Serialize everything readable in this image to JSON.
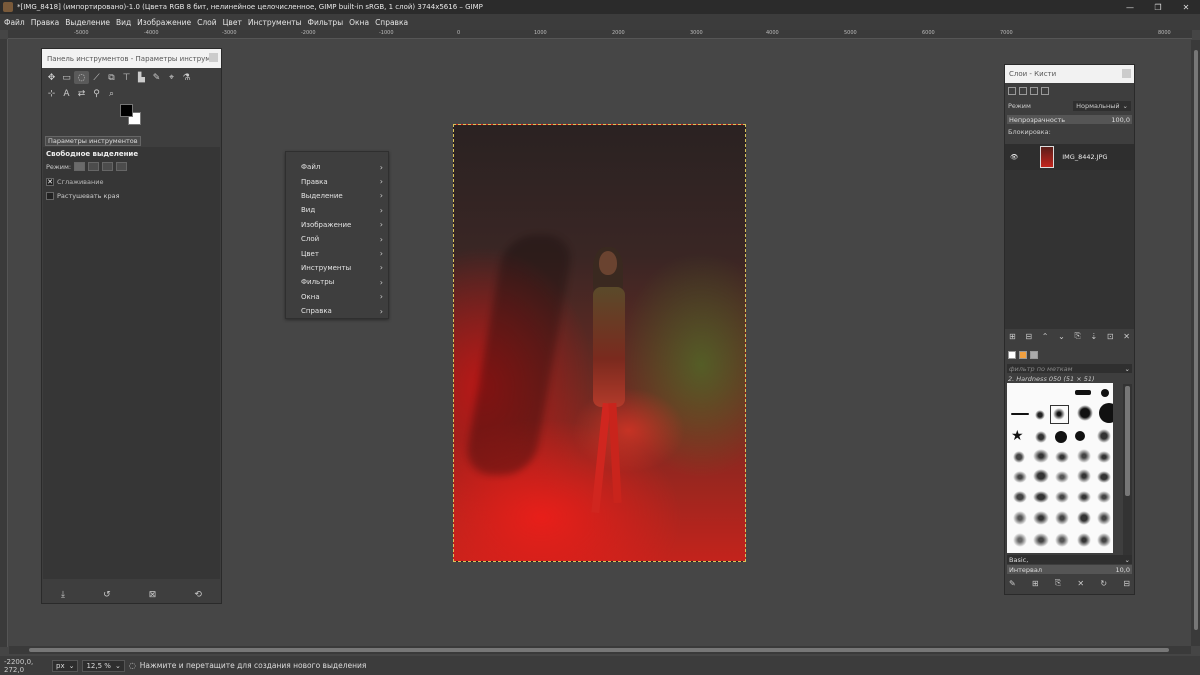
{
  "window": {
    "title": "*[IMG_8418] (импортировано)-1.0 (Цвета RGB 8 бит, нелинейное целочисленное, GIMP built-in sRGB, 1 слой) 3744x5616 – GIMP",
    "controls": [
      "—",
      "❐",
      "✕"
    ]
  },
  "menubar": [
    "Файл",
    "Правка",
    "Выделение",
    "Вид",
    "Изображение",
    "Слой",
    "Цвет",
    "Инструменты",
    "Фильтры",
    "Окна",
    "Справка"
  ],
  "ruler": {
    "ticks": [
      {
        "label": "-5000"
      },
      {
        "label": "-4000"
      },
      {
        "label": "-3000"
      },
      {
        "label": "-2000"
      },
      {
        "label": "-1000"
      },
      {
        "label": "0"
      },
      {
        "label": "1000"
      },
      {
        "label": "2000"
      },
      {
        "label": "3000"
      },
      {
        "label": "4000"
      },
      {
        "label": "5000"
      },
      {
        "label": "6000"
      },
      {
        "label": "7000"
      },
      {
        "label": "8000"
      }
    ]
  },
  "toolbox": {
    "title": "Панель инструментов - Параметры инструм...",
    "tools_row1": [
      "✥",
      "▭",
      "◌",
      "⟋",
      "⧉",
      "⊤",
      "▙",
      "✎",
      "⌖",
      "⚗"
    ],
    "tools_row2": [
      "⊹",
      "A",
      "⇄",
      "⚲",
      "⌕"
    ],
    "options_tab": "Параметры инструментов",
    "tool_name": "Свободное выделение",
    "mode_label": "Режим:",
    "antialias_label": "Сглаживание",
    "feather_label": "Растушевать края",
    "footer_icons": [
      "⤓",
      "↺",
      "⊠",
      "⟲"
    ]
  },
  "context_menu": {
    "items": [
      "Файл",
      "Правка",
      "Выделение",
      "Вид",
      "Изображение",
      "Слой",
      "Цвет",
      "Инструменты",
      "Фильтры",
      "Окна",
      "Справка"
    ]
  },
  "dock": {
    "title": "Слои - Кисти",
    "mode_label": "Режим",
    "mode_value": "Нормальный",
    "opacity_label": "Непрозрачность",
    "opacity_value": "100,0",
    "lock_label": "Блокировка:",
    "layer_name": "IMG_8442.JPG",
    "layer_buttons": [
      "⊞",
      "⊟",
      "⌃",
      "⌄",
      "⎘",
      "⇣",
      "⊡",
      "✕"
    ],
    "brush_filter_placeholder": "фильтр по меткам",
    "brush_name": "2. Hardness 050 (51 × 51)",
    "brush_preset": "Basic,",
    "spacing_label": "Интервал",
    "spacing_value": "10,0",
    "brush_buttons": [
      "✎",
      "⊞",
      "⎘",
      "✕",
      "↻",
      "⊟"
    ]
  },
  "status": {
    "coords": "-2200,0, 272,0",
    "unit": "px",
    "zoom": "12,5 %",
    "message": "Нажмите и перетащите для создания нового выделения"
  }
}
